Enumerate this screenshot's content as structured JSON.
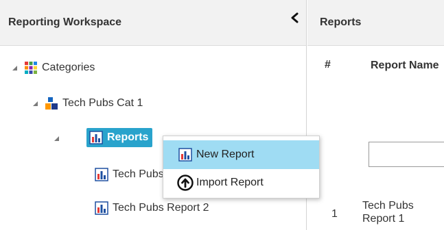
{
  "left_panel": {
    "title": "Reporting Workspace",
    "tree": {
      "categories": "Categories",
      "category1": "Tech Pubs Cat 1",
      "reports": "Reports",
      "report1": "Tech Pubs Report 1",
      "report2": "Tech Pubs Report 2"
    }
  },
  "context_menu": {
    "items": [
      {
        "label": "New Report",
        "icon": "report-chart-icon"
      },
      {
        "label": "Import Report",
        "icon": "upload-circle-icon"
      }
    ]
  },
  "right_panel": {
    "title": "Reports",
    "columns": {
      "number": "#",
      "report_name": "Report Name"
    },
    "filter_value": "",
    "rows": [
      {
        "number": "1",
        "name": "Tech Pubs Report 1"
      }
    ]
  },
  "colors": {
    "selected_node": "#29a3cc",
    "menu_highlight": "#9fdcf3",
    "header_bg": "#f2f2f2"
  }
}
